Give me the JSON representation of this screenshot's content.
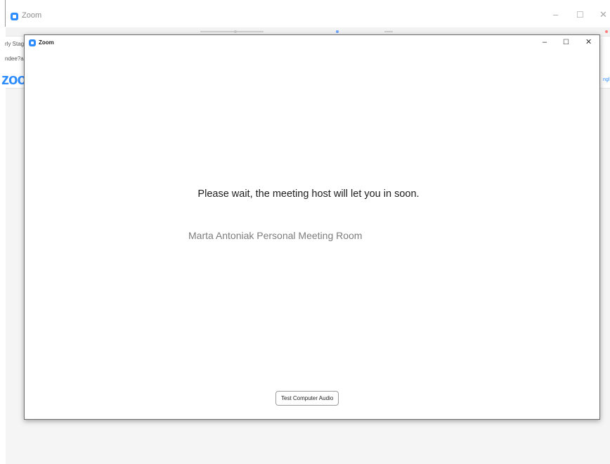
{
  "background_window": {
    "title": "Zoom",
    "controls": {
      "minimize": "–",
      "maximize": "☐",
      "close": "✕"
    },
    "page_fragments": [
      "rly Stag",
      "ndee?a"
    ],
    "brand_text": "zoom",
    "right_link_fragment": "ngl"
  },
  "dialog": {
    "title": "Zoom",
    "controls": {
      "minimize": "–",
      "maximize": "☐",
      "close": "✕"
    },
    "wait_message": "Please wait, the meeting host will let you in soon.",
    "meeting_name": "Marta Antoniak Personal Meeting Room",
    "test_audio_button": "Test Computer Audio"
  },
  "colors": {
    "brand_blue": "#2d8cff",
    "background_gray": "#f5f5f6"
  }
}
